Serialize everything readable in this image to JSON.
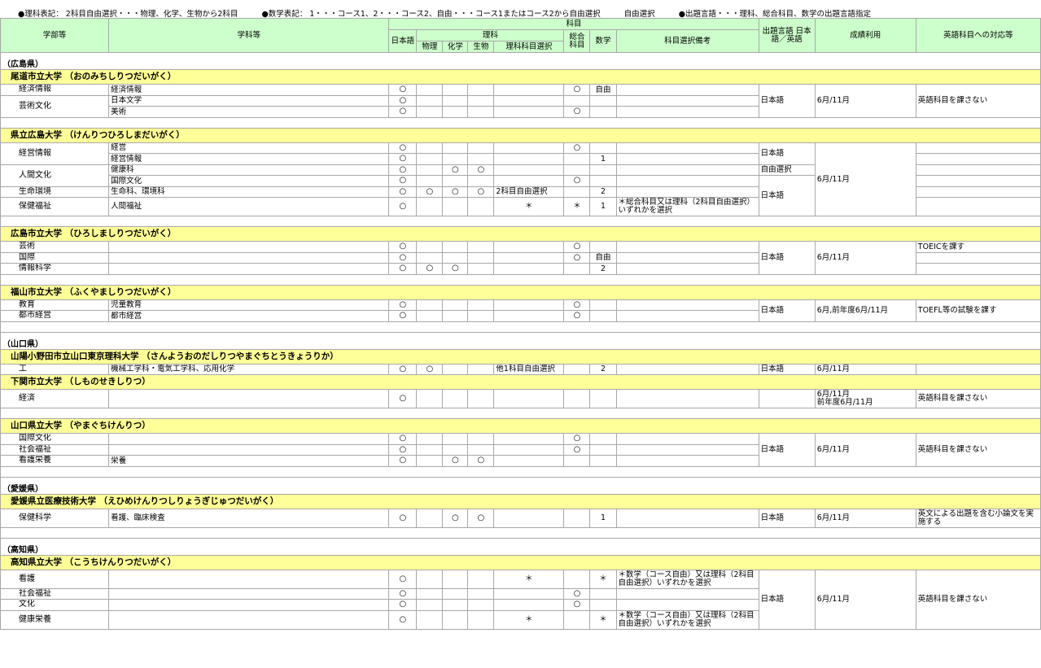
{
  "legend": {
    "rika": "●理科表記： 2科目自由選択・・・物理、化学、生物から2科目",
    "sugaku": "●数学表記： 1・・・コース1、2・・・コース2、自由・・・コース1またはコース2から自由選択",
    "jiyu": "自由選択",
    "gengo": "●出題言語・・・理科、総合科目、数学の出題言語指定"
  },
  "header": {
    "gakubu": "学部等",
    "gakka": "学科等",
    "kamoku": "科目",
    "nihongo": "日本語",
    "rika": "理科",
    "sogo": "総合科目",
    "butsuri": "物理",
    "kagaku": "化学",
    "seibutsu": "生物",
    "rika_kamoku": "理科科目選択",
    "sugaku": "数学",
    "biko": "科目選択備考",
    "gengo": "出題言語 日本語／英語",
    "seiseki": "成績利用",
    "eigo": "英語科目への対応等"
  },
  "prefectures": {
    "hiroshima": "（広島県）",
    "yamaguchi": "（山口県）",
    "ehime": "（愛媛県）",
    "kochi": "（高知県）"
  },
  "universities": {
    "onomichi": "尾道市立大学 （おのみちしりつだいがく）",
    "kenritsu_hiroshima": "県立広島大学 （けんりつひろしまだいがく）",
    "hiroshima_shiritsu": "広島市立大学 （ひろしましりつだいがく）",
    "fukuyama": "福山市立大学 （ふくやましりつだいがく）",
    "sanyo": "山陽小野田市立山口東京理科大学 （さんようおのだしりつやまぐちとうきょうりか）",
    "shimonoseki": "下関市立大学 （しものせきしりつ）",
    "yamaguchi_kenritsu": "山口県立大学 （やまぐちけんりつ）",
    "ehime_iryo": "愛媛県立医療技術大学 （えひめけんりつしりょうぎじゅつだいがく）",
    "kochi_kenritsu": "高知県立大学 （こうちけんりつだいがく）"
  },
  "marks": {
    "o": "○",
    "ast": "＊"
  },
  "common": {
    "nihongo": "日本語",
    "jiyu_sentaku": "自由選択",
    "month_6_11": "6月/11月",
    "no_english": "英語科目を課さない",
    "jiyu": "自由",
    "one": "1",
    "two": "2",
    "two_subjects": "2科目自由選択"
  },
  "onomichi": {
    "f1": "経済情報",
    "d1": "経済情報",
    "f2": "芸術文化",
    "d2": "日本文学",
    "d3": "美術"
  },
  "kenhiro": {
    "f1": "経営情報",
    "d1": "経営",
    "d2": "経営情報",
    "f2": "人間文化",
    "d3": "健康科",
    "d4": "国際文化",
    "f3": "生命環境",
    "d5": "生命科、環境科",
    "f4": "保健福祉",
    "d6": "人間福祉",
    "note": "＊総合科目又は理科（2科目自由選択）いずれかを選択"
  },
  "hiroshi": {
    "f1": "芸術",
    "f2": "国際",
    "f3": "情報科学",
    "eigo": "TOEICを課す"
  },
  "fukuyama": {
    "f1": "教育",
    "d1": "児童教育",
    "f2": "都市経営",
    "d2": "都市経営",
    "seiseki": "6月,前年度6月/11月",
    "eigo": "TOEFL等の試験を課す"
  },
  "sanyo": {
    "f1": "工",
    "d1": "機械工学科・電気工学科、応用化学",
    "rika": "他1科目自由選択"
  },
  "shimonoseki": {
    "f1": "経済",
    "seiseki1": "6月/11月",
    "seiseki2": "前年度6月/11月"
  },
  "yamakentitsu": {
    "f1": "国際文化",
    "f2": "社会福祉",
    "f3": "看護栄養",
    "d3": "栄養"
  },
  "ehime": {
    "f1": "保健科学",
    "d1": "看護、臨床検査",
    "eigo": "英文による出題を含む小論文を実施する"
  },
  "kochi": {
    "f1": "看護",
    "f2": "社会福祉",
    "f3": "文化",
    "f4": "健康栄養",
    "note": "＊数学（コース自由）又は理科（2科目自由選択）いずれかを選択"
  }
}
